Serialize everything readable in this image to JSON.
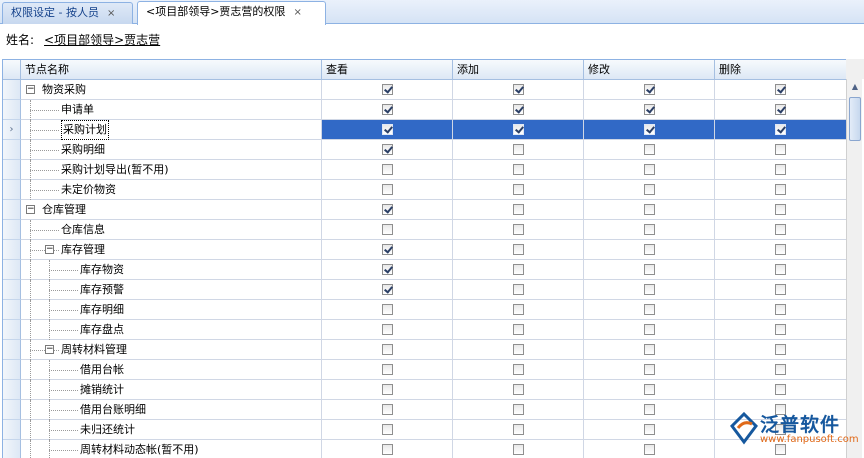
{
  "tabs": [
    {
      "label": "权限设定 - 按人员",
      "close": "×",
      "active": false
    },
    {
      "label": "<项目部领导>贾志营的权限",
      "close": "×",
      "active": true
    }
  ],
  "person": {
    "label": "姓名:",
    "value": "<项目部领导>贾志营"
  },
  "columns": {
    "node": "节点名称",
    "view": "查看",
    "add": "添加",
    "edit": "修改",
    "delete": "删除"
  },
  "selected_marker": "›",
  "rows": [
    {
      "label": "物资采购",
      "level": 0,
      "expander": "−",
      "view": true,
      "add": true,
      "edit": true,
      "delete": true
    },
    {
      "label": "申请单",
      "level": 1,
      "view": true,
      "add": true,
      "edit": true,
      "delete": true
    },
    {
      "label": "采购计划",
      "level": 1,
      "view": true,
      "add": true,
      "edit": true,
      "delete": true,
      "selected": true
    },
    {
      "label": "采购明细",
      "level": 1,
      "view": true,
      "add": false,
      "edit": false,
      "delete": false
    },
    {
      "label": "采购计划导出(暂不用)",
      "level": 1,
      "view": false,
      "add": false,
      "edit": false,
      "delete": false
    },
    {
      "label": "未定价物资",
      "level": 1,
      "view": false,
      "add": false,
      "edit": false,
      "delete": false
    },
    {
      "label": "仓库管理",
      "level": 0,
      "expander": "−",
      "view": true,
      "add": false,
      "edit": false,
      "delete": false
    },
    {
      "label": "仓库信息",
      "level": 1,
      "view": false,
      "add": false,
      "edit": false,
      "delete": false
    },
    {
      "label": "库存管理",
      "level": 1,
      "expander": "−",
      "view": true,
      "add": false,
      "edit": false,
      "delete": false
    },
    {
      "label": "库存物资",
      "level": 2,
      "view": true,
      "add": false,
      "edit": false,
      "delete": false
    },
    {
      "label": "库存预警",
      "level": 2,
      "view": true,
      "add": false,
      "edit": false,
      "delete": false
    },
    {
      "label": "库存明细",
      "level": 2,
      "view": false,
      "add": false,
      "edit": false,
      "delete": false
    },
    {
      "label": "库存盘点",
      "level": 2,
      "view": false,
      "add": false,
      "edit": false,
      "delete": false
    },
    {
      "label": "周转材料管理",
      "level": 1,
      "expander": "−",
      "view": false,
      "add": false,
      "edit": false,
      "delete": false
    },
    {
      "label": "借用台帐",
      "level": 2,
      "view": false,
      "add": false,
      "edit": false,
      "delete": false
    },
    {
      "label": "摊销统计",
      "level": 2,
      "view": false,
      "add": false,
      "edit": false,
      "delete": false
    },
    {
      "label": "借用台账明细",
      "level": 2,
      "view": false,
      "add": false,
      "edit": false,
      "delete": false
    },
    {
      "label": "未归还统计",
      "level": 2,
      "view": false,
      "add": false,
      "edit": false,
      "delete": false
    },
    {
      "label": "周转材料动态帐(暂不用)",
      "level": 2,
      "view": false,
      "add": false,
      "edit": false,
      "delete": false
    }
  ],
  "watermark": {
    "brand": "泛普软件",
    "url": "www.fanpusoft.com"
  }
}
